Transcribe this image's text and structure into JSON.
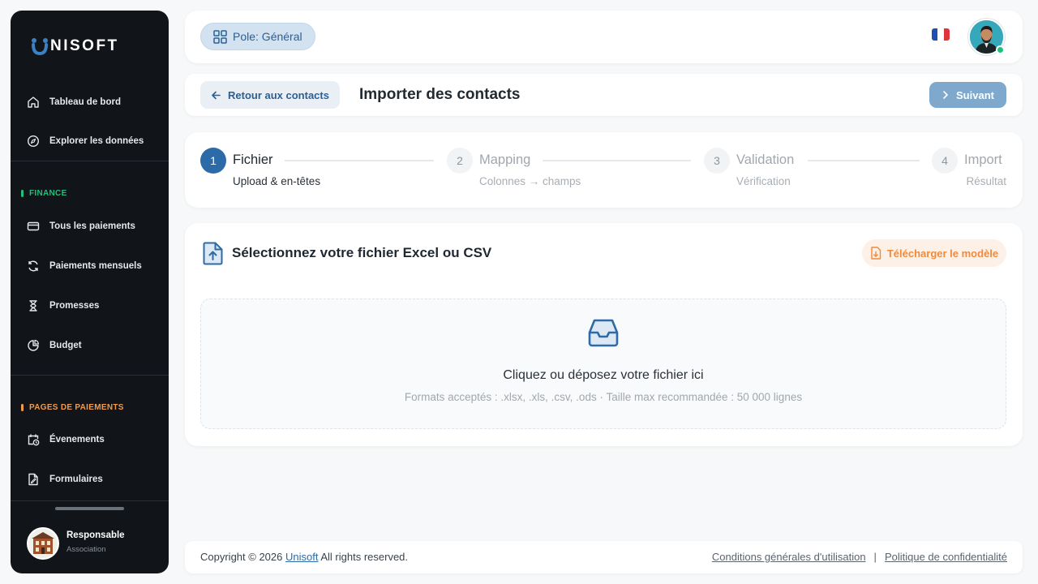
{
  "brand": {
    "name": "NISOFT",
    "accent": "#2c6aa8"
  },
  "sidebar": {
    "items": [
      {
        "label": "Tableau de bord",
        "icon": "home-icon"
      },
      {
        "label": "Explorer les données",
        "icon": "compass-icon"
      }
    ],
    "sections": [
      {
        "title": "FINANCE",
        "color": "#22c07a",
        "items": [
          {
            "label": "Tous les paiements",
            "icon": "credit-card-icon"
          },
          {
            "label": "Paiements mensuels",
            "icon": "refresh-icon"
          },
          {
            "label": "Promesses",
            "icon": "hourglass-icon"
          },
          {
            "label": "Budget",
            "icon": "pie-chart-icon"
          }
        ]
      },
      {
        "title": "PAGES DE PAIEMENTS",
        "color": "#f39b4a",
        "items": [
          {
            "label": "Évenements",
            "icon": "calendar-clock-icon"
          },
          {
            "label": "Formulaires",
            "icon": "form-file-icon"
          }
        ]
      }
    ],
    "user": {
      "name": "Responsable",
      "role": "Association"
    }
  },
  "topbar": {
    "pole_label": "Pole: Général",
    "language": "fr"
  },
  "header": {
    "back_label": "Retour aux contacts",
    "title": "Importer des contacts",
    "next_label": "Suivant"
  },
  "stepper": {
    "steps": [
      {
        "number": "1",
        "title": "Fichier",
        "subtitle": "Upload & en-têtes",
        "state": "active"
      },
      {
        "number": "2",
        "title": "Mapping",
        "subtitle": "Colonnes → champs",
        "state": "inactive"
      },
      {
        "number": "3",
        "title": "Validation",
        "subtitle": "Vérification",
        "state": "inactive"
      },
      {
        "number": "4",
        "title": "Import",
        "subtitle": "Résultat",
        "state": "inactive"
      }
    ]
  },
  "upload": {
    "title": "Sélectionnez votre fichier Excel ou CSV",
    "download_label": "Télécharger le modèle",
    "drop_title": "Cliquez ou déposez votre fichier ici",
    "drop_hint": "Formats acceptés : .xlsx, .xls, .csv, .ods · Taille max recommandée : 50 000 lignes"
  },
  "footer": {
    "copyright": "Copyright © 2026",
    "brand_link": "Unisoft",
    "rights": "All rights reserved.",
    "terms": "Conditions générales d'utilisation",
    "separator": "|",
    "privacy": "Politique de confidentialité"
  }
}
